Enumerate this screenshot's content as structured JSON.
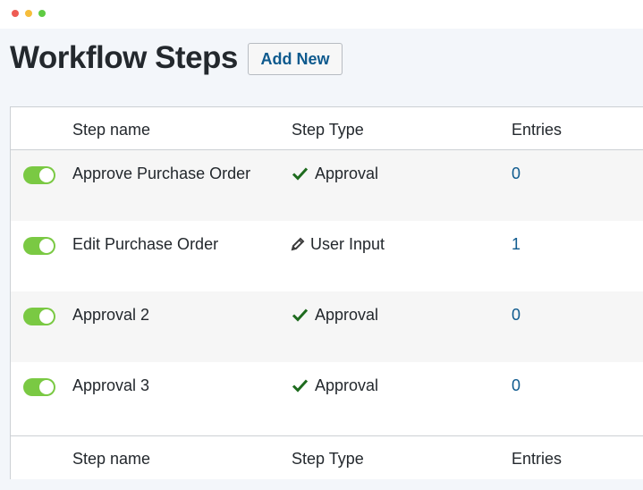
{
  "window": {
    "controls": [
      "close",
      "minimize",
      "maximize"
    ]
  },
  "page": {
    "title": "Workflow Steps",
    "add_new_label": "Add New"
  },
  "table": {
    "columns": {
      "name": "Step name",
      "type": "Step Type",
      "entries": "Entries"
    },
    "rows": [
      {
        "enabled": true,
        "name": "Approve Purchase Order",
        "type": "Approval",
        "type_icon": "checkmark-icon",
        "entries": "0"
      },
      {
        "enabled": true,
        "name": "Edit Purchase Order",
        "type": "User Input",
        "type_icon": "pencil-icon",
        "entries": "1"
      },
      {
        "enabled": true,
        "name": "Approval 2",
        "type": "Approval",
        "type_icon": "checkmark-icon",
        "entries": "0"
      },
      {
        "enabled": true,
        "name": "Approval 3",
        "type": "Approval",
        "type_icon": "checkmark-icon",
        "entries": "0"
      }
    ]
  },
  "colors": {
    "toggle_on": "#7ac943",
    "link": "#0e5a8e",
    "check": "#1e6b1e"
  }
}
